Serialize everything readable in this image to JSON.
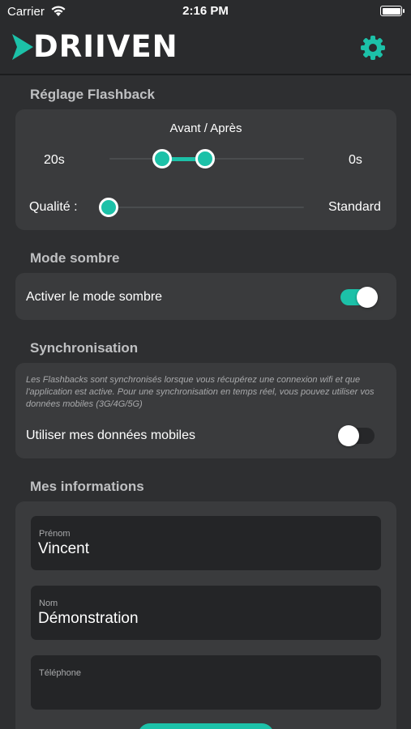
{
  "status_bar": {
    "carrier": "Carrier",
    "time": "2:16 PM"
  },
  "header": {
    "brand": "DRIIVEN"
  },
  "flashback": {
    "title": "Réglage Flashback",
    "range_title": "Avant / Après",
    "before_value": "20s",
    "after_value": "0s",
    "quality_label": "Qualité :",
    "quality_value": "Standard"
  },
  "dark_mode": {
    "title": "Mode sombre",
    "toggle_label": "Activer le mode sombre",
    "enabled": true
  },
  "sync": {
    "title": "Synchronisation",
    "note": "Les Flashbacks sont synchronisés lorsque vous récupérez une connexion wifi et que l'application est active. Pour une synchronisation en temps réel, vous pouvez utiliser vos données mobiles (3G/4G/5G)",
    "toggle_label": "Utiliser mes données mobiles",
    "enabled": false
  },
  "info": {
    "title": "Mes informations",
    "first_name_label": "Prénom",
    "first_name_value": "Vincent",
    "last_name_label": "Nom",
    "last_name_value": "Démonstration",
    "phone_label": "Téléphone",
    "phone_value": ""
  },
  "colors": {
    "accent": "#1cc1a8",
    "card": "#3a3b3d",
    "background": "#2e2f31"
  },
  "icons": [
    "wifi-icon",
    "battery-icon",
    "gear-icon",
    "logo-arrow-icon"
  ]
}
